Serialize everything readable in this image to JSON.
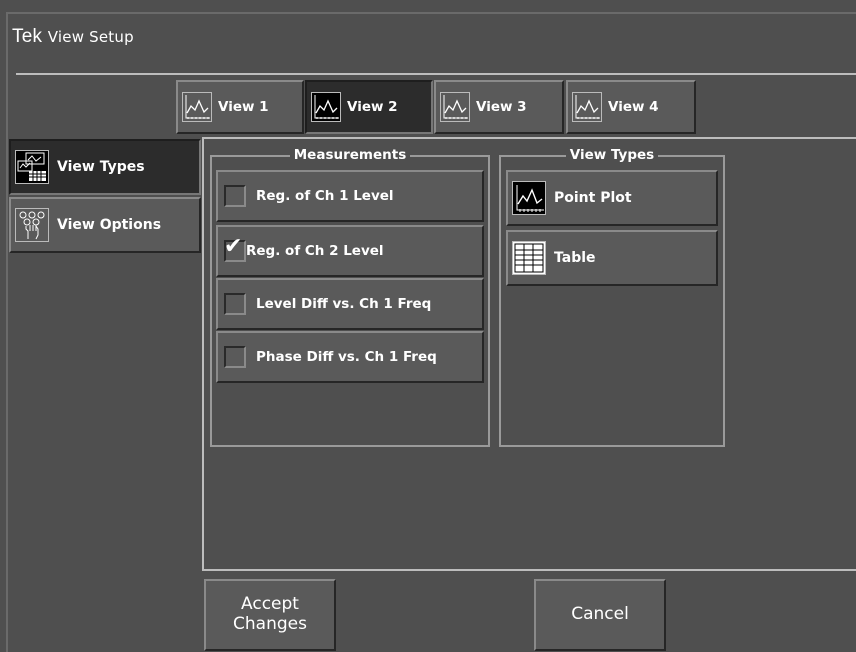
{
  "window": {
    "brand": "Tek",
    "title": "View Setup"
  },
  "tabs": [
    {
      "label": "View 1",
      "selected": false,
      "icon": "point-plot-icon"
    },
    {
      "label": "View 2",
      "selected": true,
      "icon": "point-plot-icon"
    },
    {
      "label": "View 3",
      "selected": false,
      "icon": "point-plot-icon"
    },
    {
      "label": "View 4",
      "selected": false,
      "icon": "point-plot-icon"
    }
  ],
  "side_tabs": [
    {
      "label": "View Types",
      "selected": true,
      "icon": "view-types-icon"
    },
    {
      "label": "View Options",
      "selected": false,
      "icon": "view-options-icon"
    }
  ],
  "measurements": {
    "title": "Measurements",
    "items": [
      {
        "label": "Reg. of Ch 1 Level",
        "checked": false
      },
      {
        "label": "Reg. of Ch 2 Level",
        "checked": true
      },
      {
        "label": "Level Diff vs. Ch 1 Freq",
        "checked": false
      },
      {
        "label": "Phase Diff vs. Ch 1 Freq",
        "checked": false
      }
    ]
  },
  "view_types": {
    "title": "View Types",
    "items": [
      {
        "label": "Point Plot",
        "icon": "point-plot-icon"
      },
      {
        "label": "Table",
        "icon": "table-icon"
      }
    ]
  },
  "actions": {
    "accept_line1": "Accept",
    "accept_line2": "Changes",
    "cancel": "Cancel"
  },
  "colors": {
    "background": "#4f4f4f",
    "button": "#5a5a5a",
    "selected": "#2c2c2c",
    "text": "#ffffff"
  }
}
